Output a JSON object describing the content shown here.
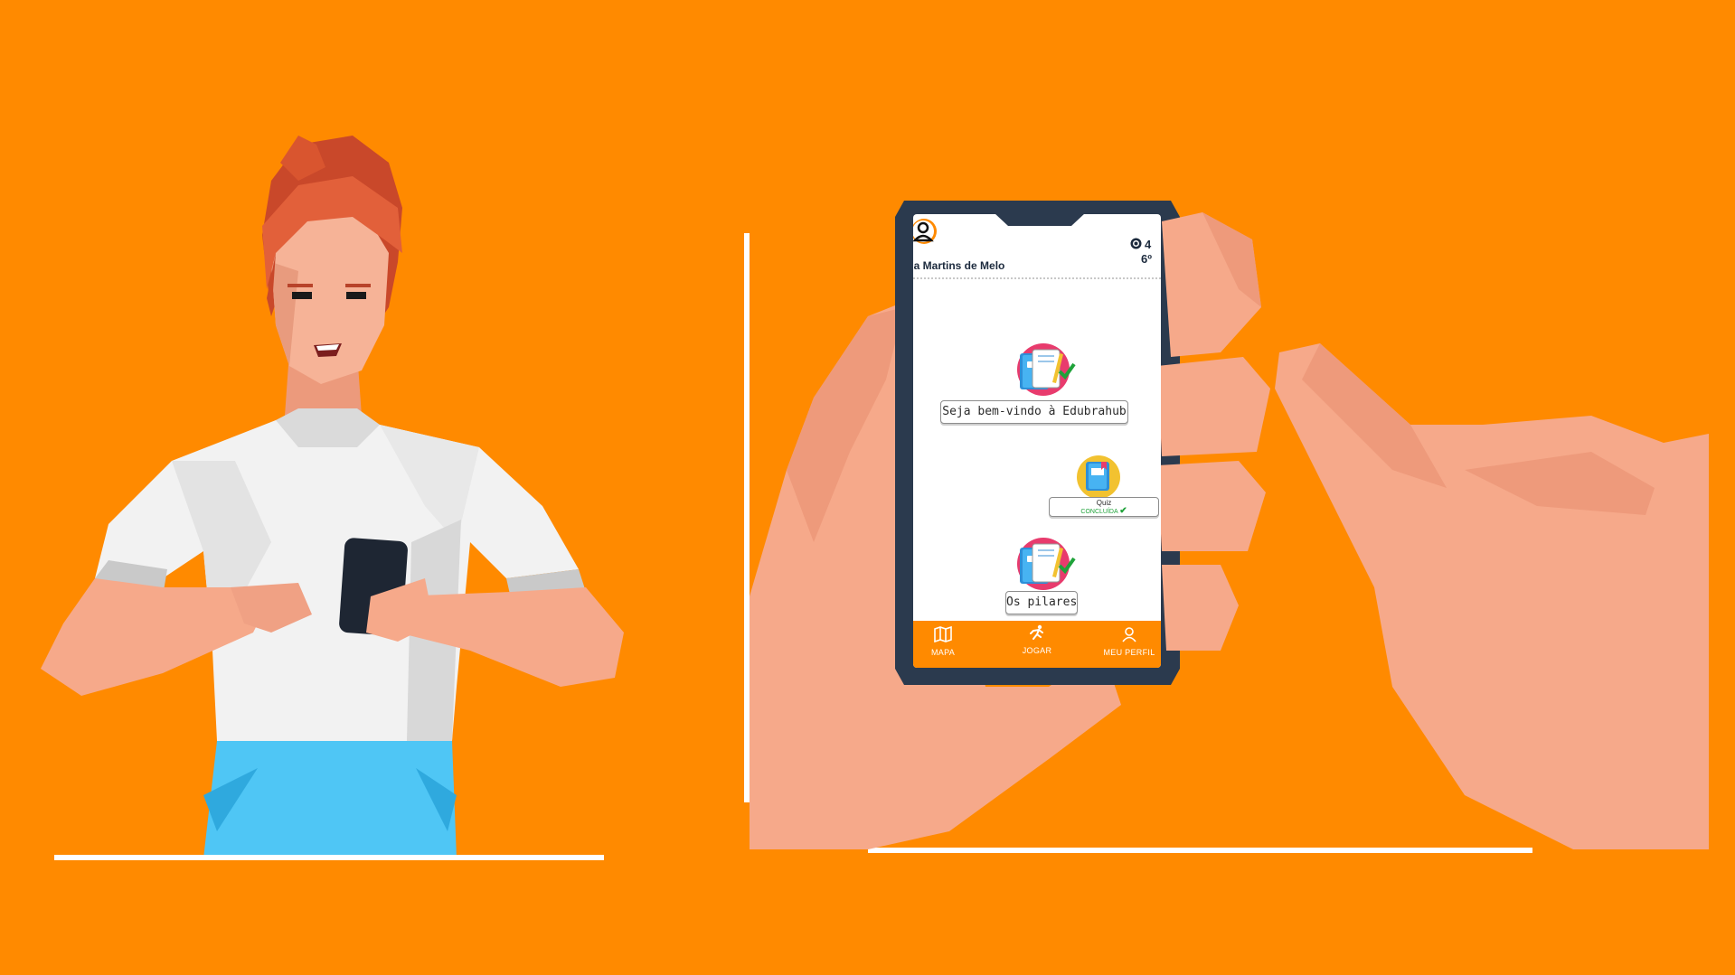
{
  "colors": {
    "background": "#FF8A00",
    "phone_frame": "#2B3A4E",
    "skin": "#F6A98A",
    "shirt": "#F2F2F2",
    "pants": "#4FC6F5",
    "hair": "#E2603A",
    "check": "#1FA23A"
  },
  "app": {
    "user_name": "lia Martins de Melo",
    "coins": "4",
    "rank": "6º",
    "icons": {
      "avatar": "user-avatar-icon",
      "coin": "coin-icon"
    }
  },
  "map": {
    "nodes": [
      {
        "label": "Seja bem-vindo à Edubrahub",
        "icon": "notebook-icon",
        "done": true
      },
      {
        "label": "Quiz",
        "status": "CONCLUÍDA",
        "icon": "quiz-book-icon",
        "done": true
      },
      {
        "label": "Os pilares",
        "icon": "notebook-icon",
        "done": true
      }
    ]
  },
  "bottom_nav": [
    {
      "label": "MAPA",
      "icon": "map-icon"
    },
    {
      "label": "JOGAR",
      "icon": "runner-icon"
    },
    {
      "label": "MEU PERFIL",
      "icon": "profile-icon"
    }
  ]
}
